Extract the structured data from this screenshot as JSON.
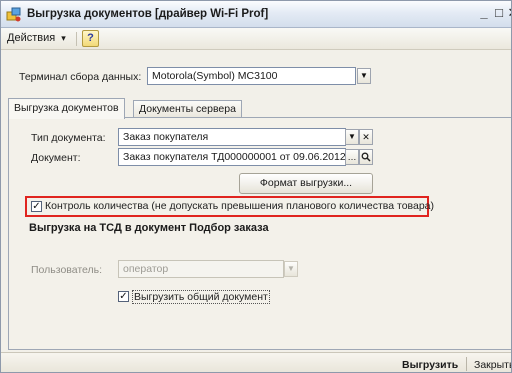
{
  "window": {
    "title": "Выгрузка документов [драйвер Wi-Fi Prof]",
    "minimize": "_",
    "maximize": "□",
    "close": "✕"
  },
  "menu": {
    "actions_label": "Действия",
    "actions_arrow": "▾",
    "help_label": "?"
  },
  "terminal": {
    "label": "Терминал сбора данных:",
    "value": "Motorola(Symbol) MC3100"
  },
  "tabs": [
    {
      "label": "Выгрузка документов",
      "active": true
    },
    {
      "label": "Документы сервера",
      "active": false
    }
  ],
  "form": {
    "doc_type_label": "Тип документа:",
    "doc_type_value": "Заказ покупателя",
    "document_label": "Документ:",
    "document_value": "Заказ покупателя ТД000000001 от 09.06.2012",
    "format_button": "Формат выгрузки...",
    "quantity_control_label": "Контроль количества (не допускать превышения планового количества товара)",
    "quantity_control_checked": true,
    "section_title": "Выгрузка на ТСД в документ Подбор заказа",
    "user_label": "Пользователь:",
    "user_placeholder": "оператор",
    "export_common_label": "Выгрузить общий документ",
    "export_common_checked": true
  },
  "footer": {
    "export_button": "Выгрузить",
    "close_button": "Закрыть"
  },
  "colors": {
    "highlight": "#e0241f",
    "window_bg": "#f2f0e9"
  }
}
